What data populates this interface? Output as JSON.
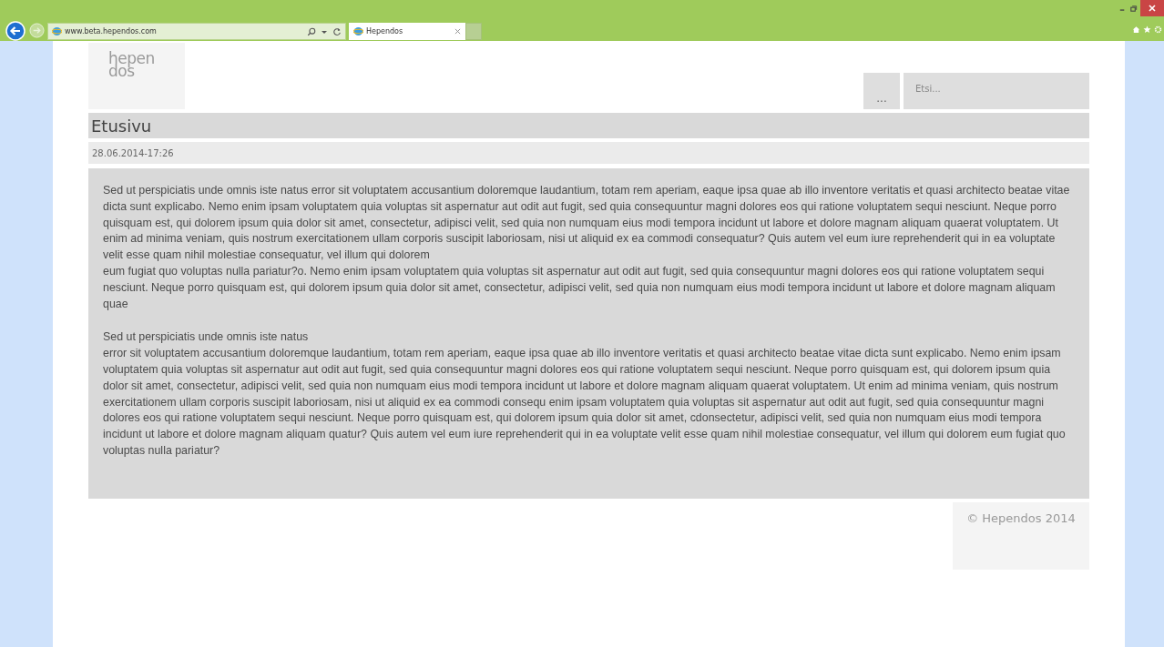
{
  "browser": {
    "address": "www.beta.hependos.com",
    "tabs": [
      {
        "title": "Hependos",
        "selected": true
      }
    ]
  },
  "site": {
    "logo_lines": [
      "hepen",
      "dos"
    ],
    "menu_button": "...",
    "search": {
      "placeholder": "Etsi..."
    }
  },
  "page": {
    "title": "Etusivu",
    "date": "28.06.2014-17:26",
    "paragraphs": [
      "Sed ut perspiciatis unde omnis iste natus error sit voluptatem accusantium doloremque laudantium, totam rem aperiam, eaque ipsa quae ab illo inventore veritatis et quasi architecto beatae vitae dicta sunt explicabo. Nemo enim ipsam voluptatem quia voluptas sit aspernatur aut odit aut fugit, sed quia consequuntur magni dolores eos qui ratione voluptatem sequi nesciunt. Neque porro quisquam est, qui dolorem ipsum quia dolor sit amet, consectetur, adipisci velit, sed quia non numquam eius modi tempora incidunt ut labore et dolore magnam aliquam quaerat voluptatem. Ut enim ad minima veniam, quis nostrum exercitationem ullam corporis suscipit laboriosam, nisi ut aliquid ex ea commodi consequatur? Quis autem vel eum iure reprehenderit qui in ea voluptate velit esse quam nihil molestiae consequatur, vel illum qui dolorem\neum fugiat quo voluptas nulla pariatur?o. Nemo enim ipsam voluptatem quia voluptas sit aspernatur aut odit aut fugit, sed quia consequuntur magni dolores eos qui ratione voluptatem sequi nesciunt. Neque porro quisquam est, qui dolorem ipsum quia dolor sit amet, consectetur, adipisci velit, sed quia non numquam eius modi tempora incidunt ut labore et dolore magnam aliquam quae",
      "Sed ut perspiciatis unde omnis iste natus\nerror sit voluptatem accusantium doloremque laudantium, totam rem aperiam, eaque ipsa quae ab illo inventore veritatis et quasi architecto beatae vitae dicta sunt explicabo. Nemo enim ipsam voluptatem quia voluptas sit aspernatur aut odit aut fugit, sed quia consequuntur magni dolores eos qui ratione voluptatem sequi nesciunt. Neque porro quisquam est, qui dolorem ipsum quia dolor sit amet, consectetur, adipisci velit, sed quia non numquam eius modi tempora incidunt ut labore et dolore magnam aliquam quaerat voluptatem. Ut enim ad minima veniam, quis nostrum exercitationem ullam corporis suscipit laboriosam, nisi ut aliquid ex ea commodi consequ enim ipsam voluptatem quia voluptas sit aspernatur aut odit aut fugit, sed quia consequuntur magni dolores eos qui ratione voluptatem sequi nesciunt. Neque porro quisquam est, qui dolorem ipsum quia dolor sit amet, cdonsectetur, adipisci velit, sed quia non numquam eius modi tempora incidunt ut labore et dolore magnam aliquam quatur? Quis autem vel eum iure reprehenderit qui in ea voluptate velit esse quam nihil molestiae consequatur, vel illum qui dolorem eum fugiat quo voluptas nulla pariatur?"
    ]
  },
  "footer": {
    "copyright": "© Hependos 2014"
  }
}
